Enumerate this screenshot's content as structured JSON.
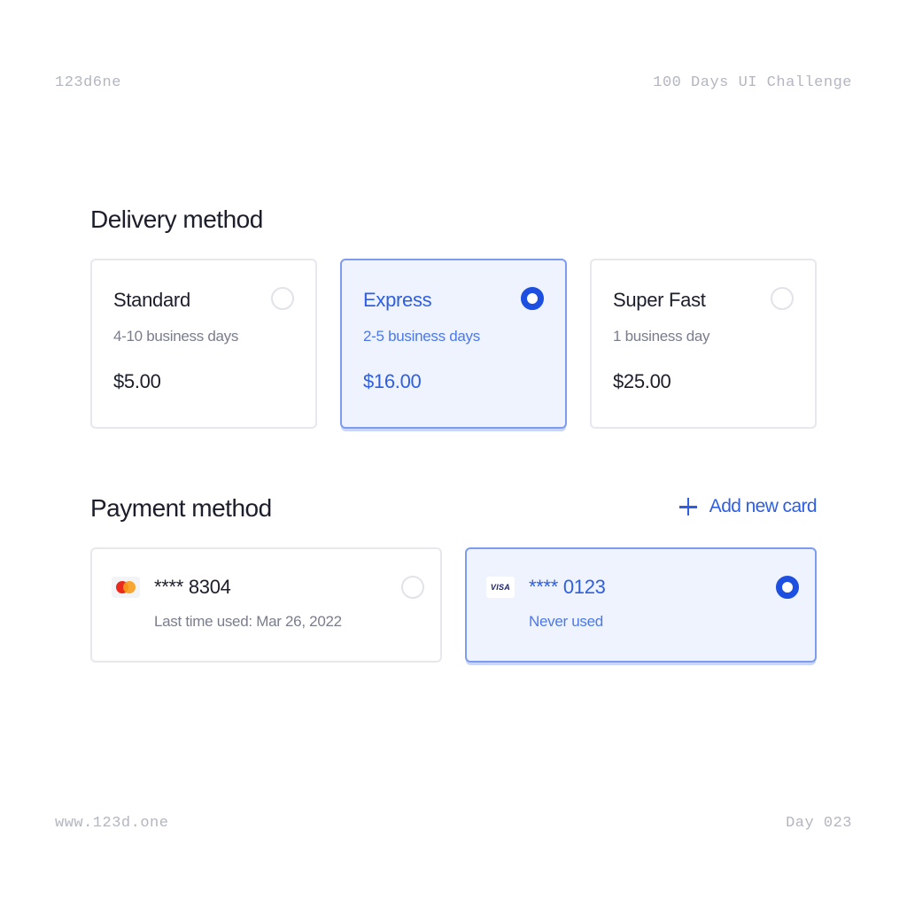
{
  "header": {
    "left": "123d6ne",
    "right": "100 Days UI Challenge"
  },
  "footer": {
    "left": "www.123d.one",
    "right": "Day 023"
  },
  "delivery": {
    "title": "Delivery method",
    "options": [
      {
        "name": "Standard",
        "days": "4-10 business days",
        "price": "$5.00",
        "selected": false
      },
      {
        "name": "Express",
        "days": "2-5 business days",
        "price": "$16.00",
        "selected": true
      },
      {
        "name": "Super Fast",
        "days": "1 business day",
        "price": "$25.00",
        "selected": false
      }
    ]
  },
  "payment": {
    "title": "Payment method",
    "add_label": "Add new card",
    "cards": [
      {
        "brand": "mastercard-icon",
        "number": "**** 8304",
        "note": "Last time used: Mar 26, 2022",
        "selected": false
      },
      {
        "brand": "visa-icon",
        "brand_text": "VISA",
        "number": "**** 0123",
        "note": "Never used",
        "selected": true
      }
    ]
  },
  "colors": {
    "accent": "#1d4fe0",
    "accent_text": "#2f5fe0",
    "selected_bg": "#eef3fe",
    "selected_border": "#7d9cf0",
    "border": "#e6e8ee"
  }
}
